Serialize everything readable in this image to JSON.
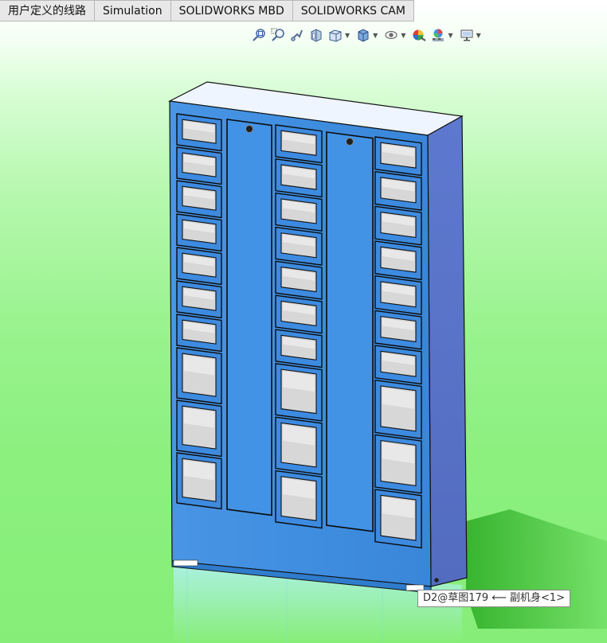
{
  "tabs": [
    {
      "label": "用户定义的线路"
    },
    {
      "label": "Simulation"
    },
    {
      "label": "SOLIDWORKS MBD"
    },
    {
      "label": "SOLIDWORKS CAM"
    }
  ],
  "heads_up_toolbar": [
    {
      "icon": "zoom-to-fit-icon"
    },
    {
      "icon": "zoom-to-area-icon"
    },
    {
      "icon": "previous-view-icon"
    },
    {
      "icon": "section-view-icon"
    },
    {
      "icon": "view-orientation-icon",
      "dropdown": true
    },
    {
      "icon": "display-style-icon",
      "dropdown": true
    },
    {
      "icon": "hide-show-items-icon",
      "dropdown": true
    },
    {
      "icon": "edit-appearance-icon"
    },
    {
      "icon": "apply-scene-icon",
      "dropdown": true
    },
    {
      "icon": "view-settings-icon",
      "dropdown": true
    }
  ],
  "model": {
    "name": "locker cabinet",
    "body_color": "#3f8fe0",
    "side_color": "#5873c9",
    "top_color": "#edf5ff",
    "left_column_compartments": {
      "small": 7,
      "large": 3
    },
    "center_column_compartments": {
      "small": 7,
      "large": 3
    },
    "right_column_compartments": {
      "small": 7,
      "large": 3
    },
    "doors": 2
  },
  "tooltip": {
    "text": "D2@草图179 ⟵ 副机身<1>"
  }
}
